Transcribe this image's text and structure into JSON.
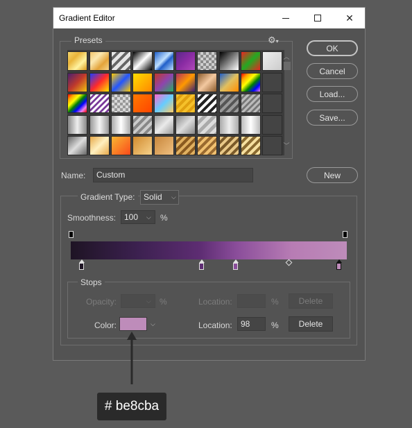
{
  "window": {
    "title": "Gradient Editor"
  },
  "presets": {
    "label": "Presets",
    "gear_icon": "gear-icon"
  },
  "buttons": {
    "ok": "OK",
    "cancel": "Cancel",
    "load": "Load...",
    "save": "Save...",
    "new": "New"
  },
  "name": {
    "label": "Name:",
    "value": "Custom"
  },
  "gradient_type": {
    "label": "Gradient Type:",
    "value": "Solid"
  },
  "smoothness": {
    "label": "Smoothness:",
    "value": "100",
    "unit": "%"
  },
  "stops": {
    "label": "Stops",
    "opacity": {
      "label": "Opacity:",
      "value": "",
      "unit": "%",
      "location_label": "Location:",
      "location_value": "",
      "location_unit": "%",
      "delete": "Delete"
    },
    "color": {
      "label": "Color:",
      "swatch": "#be8cba",
      "location_label": "Location:",
      "location_value": "98",
      "location_unit": "%",
      "delete": "Delete"
    }
  },
  "gradient": {
    "color_stops": [
      {
        "color": "#1e1424",
        "location": 4
      },
      {
        "color": "#5e2d73",
        "location": 47
      },
      {
        "color": "#8a4d9a",
        "location": 60
      },
      {
        "color": "#be8cba",
        "location": 98
      }
    ],
    "opacity_stops": [
      {
        "location": 0
      },
      {
        "location": 100
      }
    ],
    "midpoint": 79
  },
  "callout": {
    "text": "# be8cba"
  },
  "colors": {
    "accent": "#be8cba",
    "dialog_bg": "#535353",
    "page_bg": "#5a5a5a"
  }
}
